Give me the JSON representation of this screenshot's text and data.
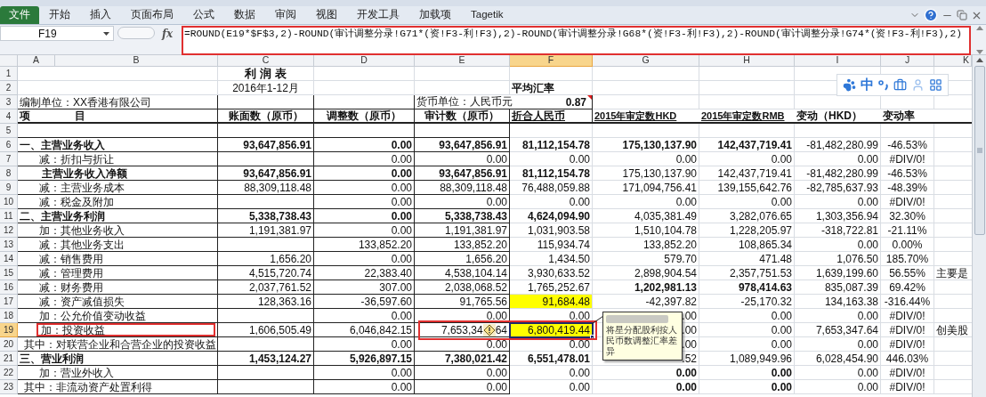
{
  "ribbon": {
    "file_tab": "文件",
    "tabs": [
      "开始",
      "插入",
      "页面布局",
      "公式",
      "数据",
      "审阅",
      "视图",
      "开发工具",
      "加载项",
      "Tagetik"
    ]
  },
  "formula_bar": {
    "name_box": "F19",
    "fx_label": "fx",
    "formula": "=ROUND(E19*$F$3,2)-ROUND(审计调整分录!G71*(资!F3-利!F3),2)-ROUND(审计调整分录!G68*(资!F3-利!F3),2)-ROUND(审计调整分录!G74*(资!F3-利!F3),2)",
    "marked": true
  },
  "columns": [
    {
      "label": "A",
      "selected": false
    },
    {
      "label": "B",
      "selected": false
    },
    {
      "label": "C",
      "selected": false
    },
    {
      "label": "D",
      "selected": false
    },
    {
      "label": "E",
      "selected": false
    },
    {
      "label": "F",
      "selected": true
    },
    {
      "label": "G",
      "selected": false
    },
    {
      "label": "H",
      "selected": false
    },
    {
      "label": "I",
      "selected": false
    },
    {
      "label": "J",
      "selected": false
    },
    {
      "label": "K",
      "selected": false
    }
  ],
  "header_rows": {
    "numbers": [
      "1",
      "2",
      "3",
      "4",
      "5"
    ],
    "title": "利 润 表",
    "period": "2016年1-12月",
    "rate_label": "平均汇率",
    "entity": "编制单位：XX香港有限公司",
    "currency": "货币单位：人民币元",
    "rate": "0.87",
    "headings": {
      "a": "项",
      "b": "目",
      "c": "账面数（原币）",
      "d": "调整数（原币）",
      "e": "审计数（原币）",
      "f": "折合人民币",
      "g": "2015年审定数HKD",
      "h": "2015年审定数RMB",
      "i": "变动（HKD）",
      "j": "变动率"
    }
  },
  "ime_toolbar": {
    "label": "中"
  },
  "rows": [
    {
      "num": "6",
      "label": "一、主营业务收入",
      "kind": "section",
      "bold_main": true,
      "bold_prior": true,
      "f_highlighted": false,
      "selected": false,
      "marked": false,
      "c": "93,647,856.91",
      "d": "0.00",
      "e": "93,647,856.91",
      "f": "81,112,154.78",
      "g": "175,130,137.90",
      "h": "142,437,719.41",
      "i": "-81,482,280.99",
      "j": "-46.53%"
    },
    {
      "num": "7",
      "label": "减：折扣与折让",
      "kind": "item",
      "bold_main": false,
      "bold_prior": false,
      "f_highlighted": false,
      "selected": false,
      "marked": false,
      "d": "0.00",
      "e": "0.00",
      "f": "0.00",
      "g": "0.00",
      "h": "0.00",
      "i": "0.00",
      "j": "#DIV/0!"
    },
    {
      "num": "8",
      "label": "主营业务收入净额",
      "kind": "subtotal",
      "bold_main": true,
      "bold_prior": false,
      "f_highlighted": false,
      "selected": false,
      "marked": false,
      "c": "93,647,856.91",
      "d": "0.00",
      "e": "93,647,856.91",
      "f": "81,112,154.78",
      "g": "175,130,137.90",
      "h": "142,437,719.41",
      "i": "-81,482,280.99",
      "j": "-46.53%"
    },
    {
      "num": "9",
      "label": "减：主营业务成本",
      "kind": "item",
      "bold_main": false,
      "bold_prior": false,
      "f_highlighted": false,
      "selected": false,
      "marked": false,
      "c": "88,309,118.48",
      "d": "0.00",
      "e": "88,309,118.48",
      "f": "76,488,059.88",
      "g": "171,094,756.41",
      "h": "139,155,642.76",
      "i": "-82,785,637.93",
      "j": "-48.39%"
    },
    {
      "num": "10",
      "label": "减：税金及附加",
      "kind": "item",
      "bold_main": false,
      "bold_prior": false,
      "f_highlighted": false,
      "selected": false,
      "marked": false,
      "d": "0.00",
      "e": "0.00",
      "f": "0.00",
      "g": "0.00",
      "h": "0.00",
      "i": "0.00",
      "j": "#DIV/0!"
    },
    {
      "num": "11",
      "label": "二、主营业务利润",
      "kind": "section",
      "bold_main": true,
      "bold_prior": false,
      "f_highlighted": false,
      "selected": false,
      "marked": false,
      "c": "5,338,738.43",
      "d": "0.00",
      "e": "5,338,738.43",
      "f": "4,624,094.90",
      "g": "4,035,381.49",
      "h": "3,282,076.65",
      "i": "1,303,356.94",
      "j": "32.30%"
    },
    {
      "num": "12",
      "label": "加：其他业务收入",
      "kind": "item",
      "bold_main": false,
      "bold_prior": false,
      "f_highlighted": false,
      "selected": false,
      "marked": false,
      "c": "1,191,381.97",
      "d": "0.00",
      "e": "1,191,381.97",
      "f": "1,031,903.58",
      "g": "1,510,104.78",
      "h": "1,228,205.97",
      "i": "-318,722.81",
      "j": "-21.11%"
    },
    {
      "num": "13",
      "label": "减：其他业务支出",
      "kind": "item",
      "bold_main": false,
      "bold_prior": false,
      "f_highlighted": false,
      "selected": false,
      "marked": false,
      "d": "133,852.20",
      "e": "133,852.20",
      "f": "115,934.74",
      "g": "133,852.20",
      "h": "108,865.34",
      "i": "0.00",
      "j": "0.00%"
    },
    {
      "num": "14",
      "label": "减：销售费用",
      "kind": "item",
      "bold_main": false,
      "bold_prior": false,
      "f_highlighted": false,
      "selected": false,
      "marked": false,
      "c": "1,656.20",
      "d": "0.00",
      "e": "1,656.20",
      "f": "1,434.50",
      "g": "579.70",
      "h": "471.48",
      "i": "1,076.50",
      "j": "185.70%"
    },
    {
      "num": "15",
      "label": "减：管理费用",
      "kind": "item",
      "bold_main": false,
      "bold_prior": false,
      "f_highlighted": false,
      "selected": false,
      "marked": false,
      "c": "4,515,720.74",
      "d": "22,383.40",
      "e": "4,538,104.14",
      "f": "3,930,633.52",
      "g": "2,898,904.54",
      "h": "2,357,751.53",
      "i": "1,639,199.60",
      "j": "56.55%",
      "k": "主要是"
    },
    {
      "num": "16",
      "label": "减：财务费用",
      "kind": "item",
      "bold_main": false,
      "bold_prior": true,
      "f_highlighted": false,
      "selected": false,
      "marked": false,
      "c": "2,037,761.52",
      "d": "307.00",
      "e": "2,038,068.52",
      "f": "1,765,252.67",
      "g": "1,202,981.13",
      "h": "978,414.63",
      "i": "835,087.39",
      "j": "69.42%"
    },
    {
      "num": "17",
      "label": "减：资产减值损失",
      "kind": "item",
      "bold_main": false,
      "bold_prior": false,
      "f_highlighted": true,
      "selected": false,
      "marked": false,
      "c": "128,363.16",
      "d": "-36,597.60",
      "e": "91,765.56",
      "f": "91,684.48",
      "g": "-42,397.82",
      "h": "-25,170.32",
      "i": "134,163.38",
      "j": "-316.44%"
    },
    {
      "num": "18",
      "label": "加：公允价值变动收益",
      "kind": "item",
      "bold_main": false,
      "bold_prior": false,
      "f_highlighted": false,
      "selected": false,
      "marked": false,
      "d": "0.00",
      "e": "0.00",
      "f": "0.00",
      "g": ".00",
      "h": "0.00",
      "i": "0.00",
      "j": "#DIV/0!"
    },
    {
      "num": "19",
      "label": "加：投资收益",
      "kind": "item",
      "bold_main": false,
      "bold_prior": false,
      "f_highlighted": true,
      "selected": true,
      "marked": true,
      "c": "1,606,505.49",
      "d": "6,046,842.15",
      "e_parts": [
        "7,653,34",
        "64"
      ],
      "f": "6,800,419.44",
      "g": ".00",
      "h": "0.00",
      "i": "7,653,347.64",
      "j": "#DIV/0!",
      "k": "创美股"
    },
    {
      "num": "20",
      "label": "其中：对联营企业和合营企业的投资收益",
      "kind": "sub",
      "bold_main": false,
      "bold_prior": false,
      "f_highlighted": false,
      "selected": false,
      "marked": false,
      "d": "0.00",
      "e": "0.00",
      "f": "0.00",
      "g": ".00",
      "h": "0.00",
      "i": "0.00",
      "j": "#DIV/0!"
    },
    {
      "num": "21",
      "label": "三、营业利润",
      "kind": "section",
      "bold_main": true,
      "bold_prior": false,
      "f_highlighted": false,
      "selected": false,
      "marked": false,
      "c": "1,453,124.27",
      "d": "5,926,897.15",
      "e": "7,380,021.42",
      "f": "6,551,478.01",
      "g": ".52",
      "h": "1,089,949.96",
      "i": "6,028,454.90",
      "j": "446.03%"
    },
    {
      "num": "22",
      "label": "加：营业外收入",
      "kind": "item",
      "bold_main": false,
      "bold_prior": true,
      "f_highlighted": false,
      "selected": false,
      "marked": false,
      "d": "0.00",
      "e": "0.00",
      "f": "0.00",
      "g": "0.00",
      "h": "0.00",
      "i": "0.00",
      "j": "#DIV/0!"
    },
    {
      "num": "23",
      "label": "其中：非流动资产处置利得",
      "kind": "sub",
      "bold_main": false,
      "bold_prior": true,
      "f_highlighted": false,
      "selected": false,
      "marked": false,
      "d": "0.00",
      "e": "0.00",
      "f": "0.00",
      "g": "0.00",
      "h": "0.00",
      "i": "0.00",
      "j": "#DIV/0!"
    }
  ],
  "comment": {
    "text": "将星分配股利按人民币数调整汇率差异"
  }
}
